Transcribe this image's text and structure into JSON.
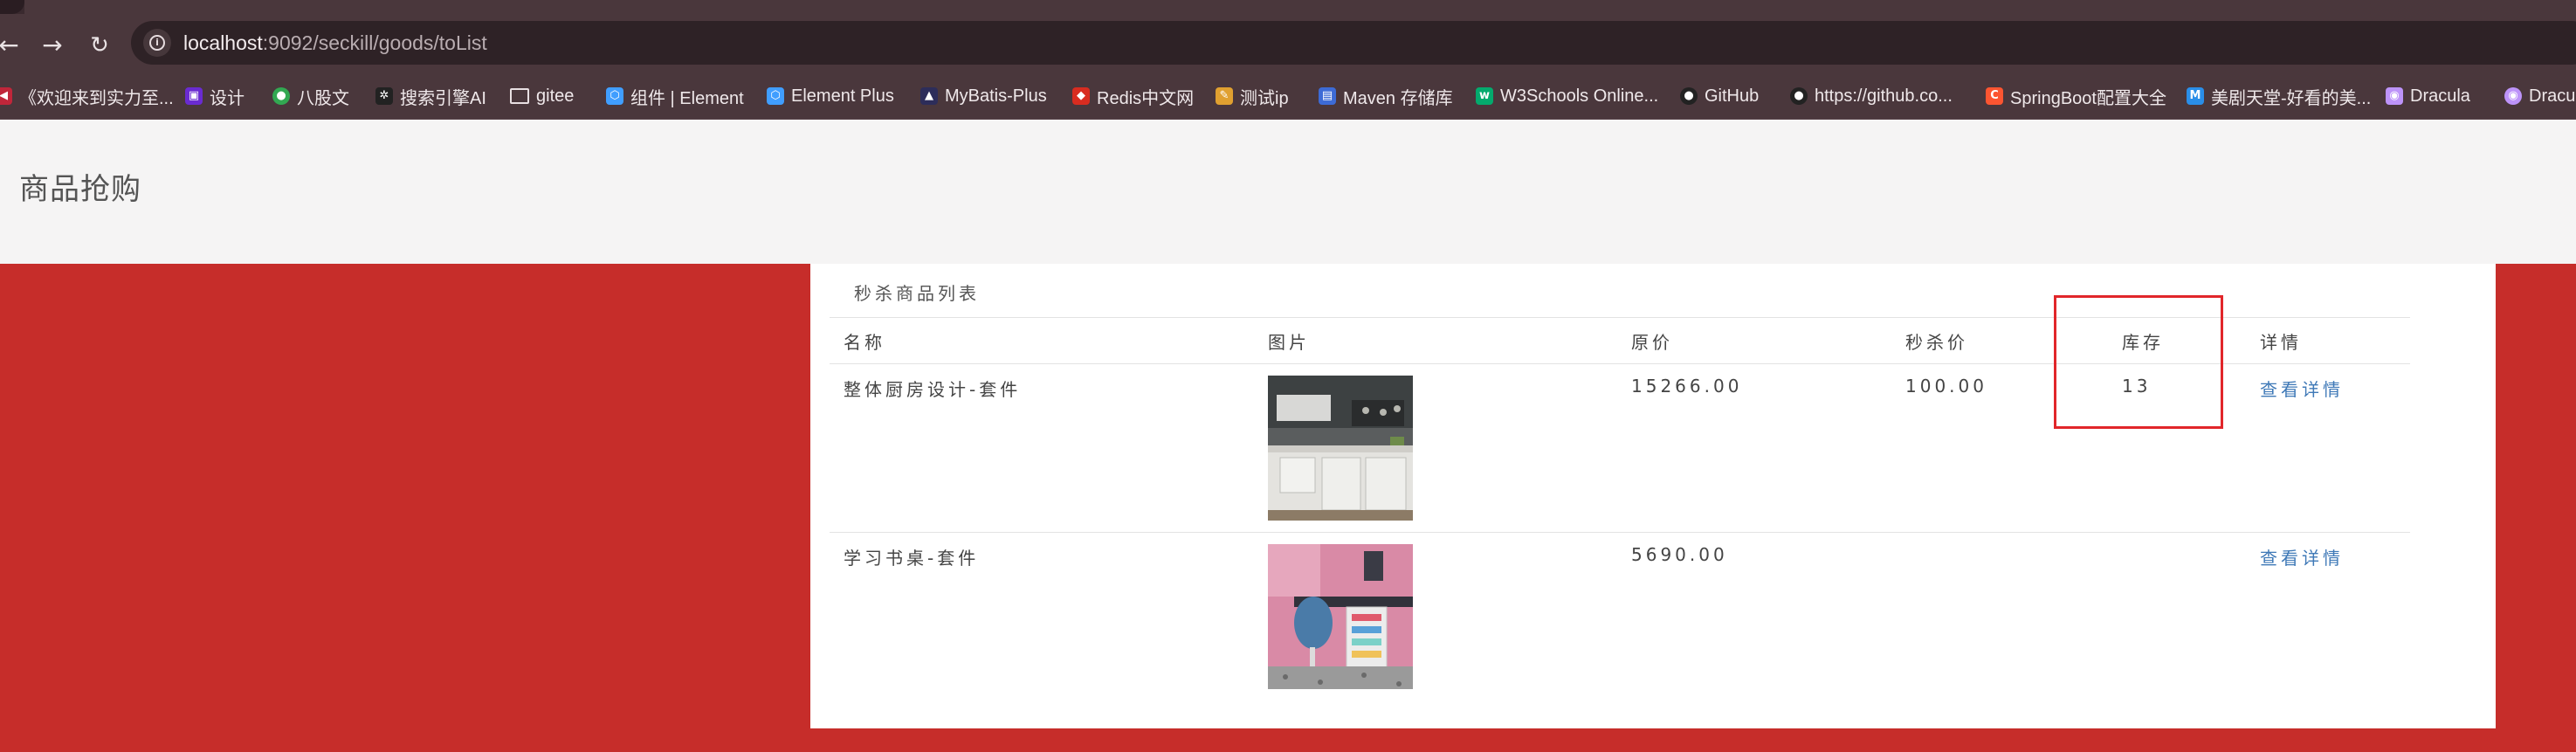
{
  "browser": {
    "url_host": "localhost",
    "url_path": ":9092/seckill/goods/toList",
    "bookmarks": [
      {
        "label": "《欢迎来到实力至...",
        "icon": "flag-icon",
        "color": "#c0263a"
      },
      {
        "label": "设计",
        "icon": "design-icon",
        "color": "#6a2bd1"
      },
      {
        "label": "八股文",
        "icon": "leaf-icon",
        "color": "#32a852"
      },
      {
        "label": "搜索引擎AI",
        "icon": "ai-icon",
        "color": "#222222"
      },
      {
        "label": "gitee",
        "icon": "folder-icon",
        "color": "#4a373c"
      },
      {
        "label": "组件 | Element",
        "icon": "element-icon",
        "color": "#409eff"
      },
      {
        "label": "Element Plus",
        "icon": "element-plus-icon",
        "color": "#409eff"
      },
      {
        "label": "MyBatis-Plus",
        "icon": "mybatis-icon",
        "color": "#2d2d5a"
      },
      {
        "label": "Redis中文网",
        "icon": "redis-icon",
        "color": "#d82c20"
      },
      {
        "label": "测试ip",
        "icon": "tool-icon",
        "color": "#e0a030"
      },
      {
        "label": "Maven 存储库",
        "icon": "maven-icon",
        "color": "#3d6bd6"
      },
      {
        "label": "W3Schools Online...",
        "icon": "w3schools-icon",
        "color": "#04aa6d"
      },
      {
        "label": "GitHub",
        "icon": "github-icon",
        "color": "#222222"
      },
      {
        "label": "https://github.co...",
        "icon": "github-icon",
        "color": "#222222"
      },
      {
        "label": "SpringBoot配置大全",
        "icon": "csdn-icon",
        "color": "#fc5531"
      },
      {
        "label": "美剧天堂-好看的美...",
        "icon": "tv-icon",
        "color": "#2a8ee8"
      },
      {
        "label": "Dracula",
        "icon": "dracula-icon",
        "color": "#bd93f9"
      },
      {
        "label": "Dracu",
        "icon": "dracula-icon",
        "color": "#bd93f9"
      }
    ]
  },
  "page": {
    "title": "商品抢购",
    "panel_title": "秒杀商品列表",
    "headers": {
      "name": "名称",
      "image": "图片",
      "price": "原价",
      "seckill_price": "秒杀价",
      "stock": "库存",
      "detail": "详情"
    },
    "rows": [
      {
        "name": "整体厨房设计-套件",
        "price": "15266.00",
        "seckill_price": "100.00",
        "stock": "13",
        "detail": "查看详情",
        "image": "kitchen-photo"
      },
      {
        "name": "学习书桌-套件",
        "price": "5690.00",
        "seckill_price": "",
        "stock": "",
        "detail": "查看详情",
        "image": "desk-photo"
      }
    ]
  },
  "colors": {
    "page_bg": "#c62d2a",
    "header_bg": "#f5f4f4",
    "link": "#3f79b7",
    "highlight": "#e1262a"
  }
}
